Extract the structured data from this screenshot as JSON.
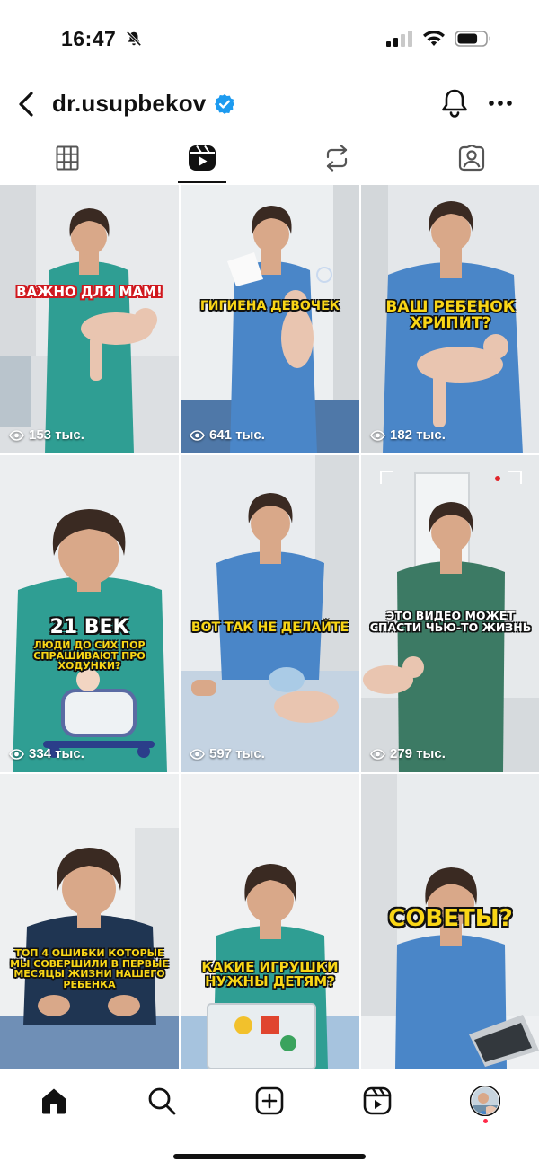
{
  "status_bar": {
    "time": "16:47",
    "battery_level": 0.72
  },
  "header": {
    "username": "dr.usupbekov",
    "verified": true
  },
  "tabs": [
    {
      "icon": "grid-icon",
      "active": false
    },
    {
      "icon": "reels-icon",
      "active": true
    },
    {
      "icon": "reposts-icon",
      "active": false
    },
    {
      "icon": "tagged-icon",
      "active": false
    }
  ],
  "reels": [
    {
      "caption": "ВАЖНО ДЛЯ МАМ!",
      "views": "153 тыс."
    },
    {
      "caption": "ГИГИЕНА ДЕВОЧЕК",
      "views": "641 тыс."
    },
    {
      "caption": "ВАШ РЕБЕНОК ХРИПИТ?",
      "views": "182 тыс."
    },
    {
      "caption_big": "21 ВЕК",
      "caption": "ЛЮДИ ДО СИХ ПОР СПРАШИВАЮТ ПРО ХОДУНКИ?",
      "views": "334 тыс."
    },
    {
      "caption": "ВОТ ТАК НЕ ДЕЛАЙТЕ",
      "views": "597 тыс."
    },
    {
      "caption": "ЭТО ВИДЕО МОЖЕТ СПАСТИ ЧЬЮ-ТО ЖИЗНЬ",
      "views": "279 тыс."
    },
    {
      "caption": "ТОП 4 ОШИБКИ КОТОРЫЕ МЫ СОВЕРШИЛИ В ПЕРВЫЕ МЕСЯЦЫ ЖИЗНИ НАШЕГО РЕБЕНКА"
    },
    {
      "caption": "КАКИЕ ИГРУШКИ НУЖНЫ ДЕТЯМ?"
    },
    {
      "caption": "СОВЕТЫ?"
    }
  ],
  "bottom_nav": [
    {
      "icon": "home-icon",
      "active": true
    },
    {
      "icon": "search-icon"
    },
    {
      "icon": "create-icon"
    },
    {
      "icon": "reels-icon"
    },
    {
      "icon": "profile-avatar",
      "has_notification": true
    }
  ],
  "colors": {
    "scrub_teal": "#2f9e93",
    "scrub_blue": "#4a86c8",
    "scrub_green": "#3c7a64",
    "scrub_navy": "#1f3552",
    "caption_yellow": "#f9d616",
    "caption_red": "#d0181e",
    "verified_blue": "#1d9bf0"
  }
}
